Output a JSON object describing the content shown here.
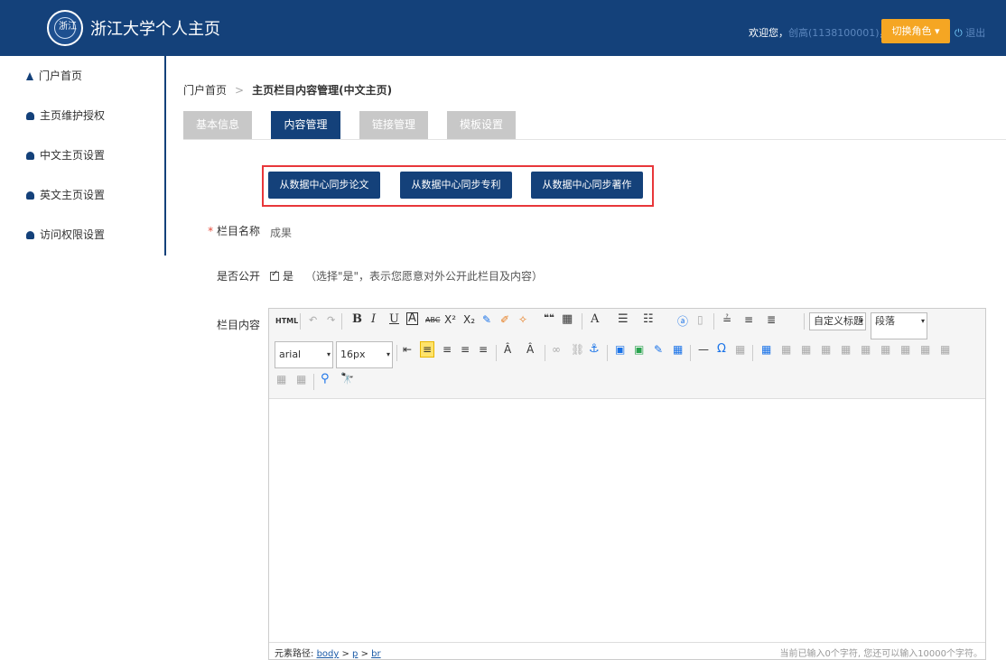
{
  "header": {
    "logo_text": "浙江",
    "site_title": "浙江大学个人主页",
    "welcome_prefix": "欢迎您，",
    "user_name": "创高(1138100001)",
    "welcome_suffix": "，",
    "role_button": "切换角色 ▾",
    "logout_icon": "logout-icon",
    "logout": "退出"
  },
  "sidebar": {
    "items": [
      {
        "label": "门户首页",
        "icon": "home-icon"
      },
      {
        "label": "主页维护授权",
        "icon": "user-icon"
      },
      {
        "label": "中文主页设置",
        "icon": "user-icon"
      },
      {
        "label": "英文主页设置",
        "icon": "user-icon"
      },
      {
        "label": "访问权限设置",
        "icon": "user-icon"
      }
    ]
  },
  "breadcrumb": {
    "home": "门户首页",
    "separator": ">",
    "current": "主页栏目内容管理(中文主页)"
  },
  "tabs": [
    {
      "label": "基本信息",
      "active": false
    },
    {
      "label": "内容管理",
      "active": true
    },
    {
      "label": "链接管理",
      "active": false
    },
    {
      "label": "模板设置",
      "active": false
    }
  ],
  "sync_buttons": [
    "从数据中心同步论文",
    "从数据中心同步专利",
    "从数据中心同步著作"
  ],
  "form": {
    "required_mark": "*",
    "column_name_label": "栏目名称",
    "column_name_value": "成果",
    "public_label": "是否公开",
    "public_value": "是",
    "public_hint": "（选择\"是\"，表示您愿意对外公开此栏目及内容）",
    "content_label": "栏目内容"
  },
  "editor": {
    "font_family": "arial",
    "font_size": "16px",
    "heading_style": "自定义标题",
    "paragraph": "段落",
    "path_prefix": "元素路径: ",
    "path_body": "body",
    "path_p": "p",
    "path_br": "br",
    "path_sep": " > ",
    "char_count": "当前已输入0个字符, 您还可以输入10000个字符。",
    "toolbar_row1": [
      "HTML",
      "↶",
      "↷",
      "B",
      "I",
      "U",
      "A",
      "ABC",
      "X²",
      "X₂",
      "✎",
      "✐",
      "✧",
      "❝❝",
      "▦",
      "A",
      "☰",
      "☷",
      "ⓐ",
      "▯",
      "≟",
      "≡",
      "≣"
    ],
    "toolbar_row2": [
      "⇤",
      "≡",
      "≡",
      "≡",
      "≡",
      "Â",
      "Â",
      "∞",
      "⛓",
      "⚓",
      "▣",
      "▣",
      "✎",
      "▦",
      "—",
      "Ω",
      "▦",
      "▦",
      "▦",
      "▦",
      "▦",
      "▦",
      "▦",
      "▦",
      "▦",
      "▦",
      "▦"
    ],
    "toolbar_row3": [
      "▦",
      "▦",
      "⚲",
      "🔭"
    ]
  }
}
